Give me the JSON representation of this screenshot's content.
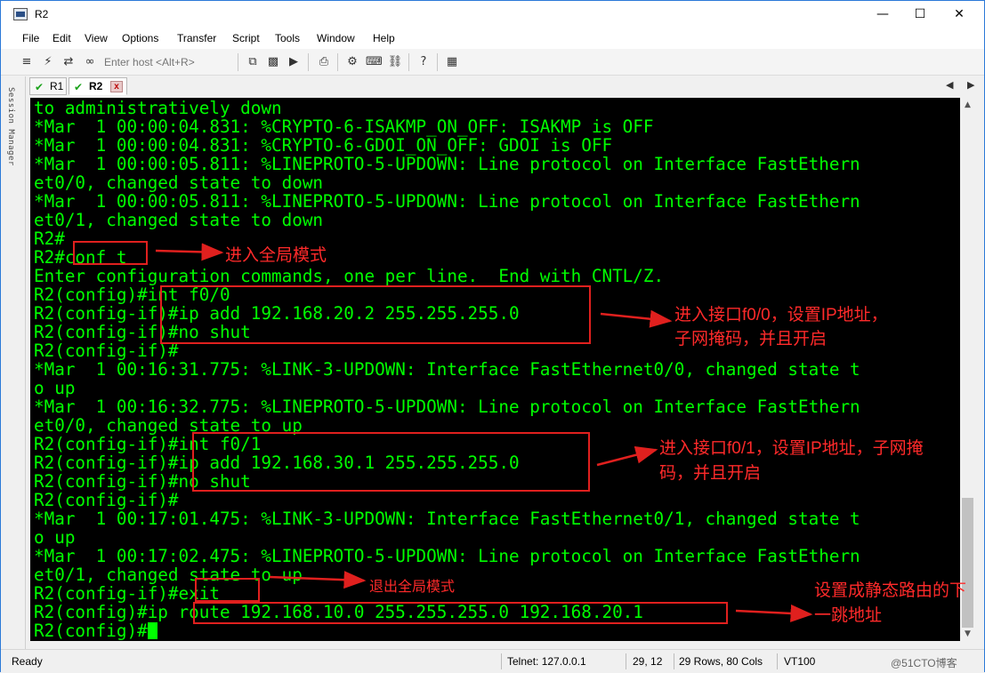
{
  "window": {
    "title": "R2",
    "controls": [
      "minimize",
      "maximize",
      "close"
    ]
  },
  "menu": [
    "File",
    "Edit",
    "View",
    "Options",
    "Transfer",
    "Script",
    "Tools",
    "Window",
    "Help"
  ],
  "toolbar": {
    "host_placeholder": "Enter host <Alt+R>",
    "icons": [
      "connect-icon",
      "lightning-icon",
      "reconnect-icon",
      "link-icon",
      "copy-icon",
      "paste-icon",
      "find-icon",
      "print-icon",
      "settings-icon",
      "keymap-icon",
      "sftp-icon",
      "help-icon",
      "screen-icon"
    ]
  },
  "sidebar": {
    "label": "Session Manager"
  },
  "tabs": [
    {
      "label": "R1",
      "active": false
    },
    {
      "label": "R2",
      "active": true
    }
  ],
  "tab_close": "x",
  "terminal": {
    "lines": [
      "to administratively down",
      "*Mar  1 00:00:04.831: %CRYPTO-6-ISAKMP_ON_OFF: ISAKMP is OFF",
      "*Mar  1 00:00:04.831: %CRYPTO-6-GDOI_ON_OFF: GDOI is OFF",
      "*Mar  1 00:00:05.811: %LINEPROTO-5-UPDOWN: Line protocol on Interface FastEthern",
      "et0/0, changed state to down",
      "*Mar  1 00:00:05.811: %LINEPROTO-5-UPDOWN: Line protocol on Interface FastEthern",
      "et0/1, changed state to down",
      "R2#",
      "R2#conf t",
      "Enter configuration commands, one per line.  End with CNTL/Z.",
      "R2(config)#int f0/0",
      "R2(config-if)#ip add 192.168.20.2 255.255.255.0",
      "R2(config-if)#no shut",
      "R2(config-if)#",
      "*Mar  1 00:16:31.775: %LINK-3-UPDOWN: Interface FastEthernet0/0, changed state t",
      "o up",
      "*Mar  1 00:16:32.775: %LINEPROTO-5-UPDOWN: Line protocol on Interface FastEthern",
      "et0/0, changed state to up",
      "R2(config-if)#int f0/1",
      "R2(config-if)#ip add 192.168.30.1 255.255.255.0",
      "R2(config-if)#no shut",
      "R2(config-if)#",
      "*Mar  1 00:17:01.475: %LINK-3-UPDOWN: Interface FastEthernet0/1, changed state t",
      "o up",
      "*Mar  1 00:17:02.475: %LINEPROTO-5-UPDOWN: Line protocol on Interface FastEthern",
      "et0/1, changed state to up",
      "R2(config-if)#exit",
      "R2(config)#ip route 192.168.10.0 255.255.255.0 192.168.20.1",
      "R2(config)#"
    ]
  },
  "annotations": {
    "global_mode": "进入全局模式",
    "f00_line1": "进入接口f0/0，设置IP地址，",
    "f00_line2": "子网掩码，并且开启",
    "f01_line1": "进入接口f0/1，设置IP地址，子网掩",
    "f01_line2": "码，并且开启",
    "exit_mode": "退出全局模式",
    "route_line1": "设置成静态路由的下",
    "route_line2": "一跳地址"
  },
  "status": {
    "ready": "Ready",
    "connection": "Telnet: 127.0.0.1",
    "cursor": "29,  12",
    "size": "29 Rows, 80 Cols",
    "term": "VT100",
    "watermark": "@51CTO博客"
  },
  "colors": {
    "terminal_bg": "#000000",
    "terminal_fg": "#00ff00",
    "annotation": "#ff2a2a"
  }
}
